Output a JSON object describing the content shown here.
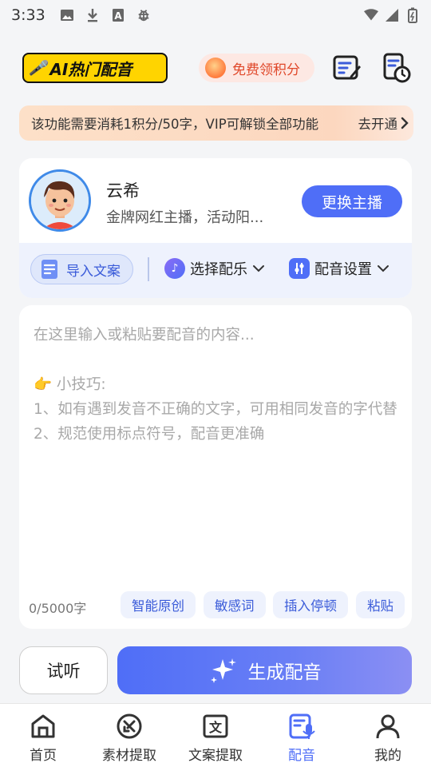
{
  "status_bar": {
    "time": "3:33",
    "left_icons": [
      "image-icon",
      "download-icon",
      "a-badge-icon",
      "bug-icon"
    ],
    "right_icons": [
      "wifi-icon",
      "signal-icon",
      "battery-icon"
    ]
  },
  "header": {
    "logo_text": "AI热门配音",
    "points_label": "免费领积分",
    "right_icons": [
      "edit-list-icon",
      "history-icon"
    ]
  },
  "banner": {
    "text": "该功能需要消耗1积分/50字，VIP可解锁全部功能",
    "cta": "去开通"
  },
  "anchor": {
    "name": "云希",
    "description": "金牌网红主播，活动阳...",
    "swap_label": "更换主播"
  },
  "tools": {
    "import_label": "导入文案",
    "music_label": "选择配乐",
    "settings_label": "配音设置"
  },
  "editor": {
    "placeholder": "在这里输入或粘贴要配音的内容...\n\n👉 小技巧:\n1、如有遇到发音不正确的文字，可用相同发音的字代替\n2、规范使用标点符号，配音更准确",
    "counter": "0/5000字",
    "chips": [
      "智能原创",
      "敏感词",
      "插入停顿",
      "粘贴"
    ]
  },
  "actions": {
    "listen_label": "试听",
    "generate_label": "生成配音"
  },
  "tabbar": {
    "items": [
      {
        "label": "首页",
        "icon": "home-icon"
      },
      {
        "label": "素材提取",
        "icon": "material-extract-icon"
      },
      {
        "label": "文案提取",
        "icon": "text-extract-icon"
      },
      {
        "label": "配音",
        "icon": "dubbing-icon"
      },
      {
        "label": "我的",
        "icon": "profile-icon"
      }
    ],
    "active": "配音"
  },
  "colors": {
    "accent": "#4f6ef7",
    "logo_yellow": "#ffd400",
    "points_red": "#e0482a"
  }
}
